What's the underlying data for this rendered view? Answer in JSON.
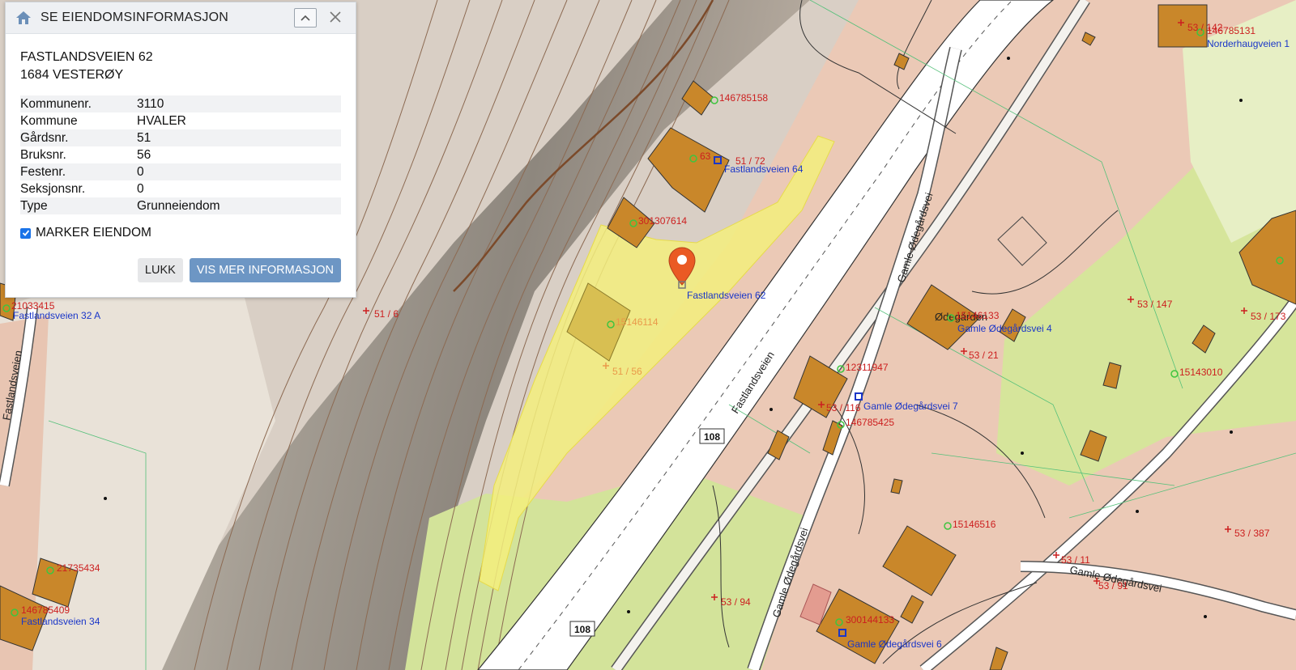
{
  "panel": {
    "title": "SE EIENDOMSINFORMASJON",
    "address_line1": "FASTLANDSVEIEN 62",
    "address_line2": "1684 VESTERØY",
    "properties": [
      {
        "key": "Kommunenr.",
        "value": "3110"
      },
      {
        "key": "Kommune",
        "value": "HVALER"
      },
      {
        "key": "Gårdsnr.",
        "value": "51"
      },
      {
        "key": "Bruksnr.",
        "value": "56"
      },
      {
        "key": "Festenr.",
        "value": "0"
      },
      {
        "key": "Seksjonsnr.",
        "value": "0"
      },
      {
        "key": "Type",
        "value": "Grunneiendom"
      }
    ],
    "mark_property_label": "MARKER EIENDOM",
    "mark_property_checked": true,
    "close_label": "LUKK",
    "more_info_label": "VIS MER INFORMASJON",
    "icons": {
      "home": "home-icon",
      "collapse": "chevron-up-icon",
      "close": "close-icon"
    }
  },
  "map": {
    "road_numbers": [
      "108",
      "108"
    ],
    "road_names": [
      "Fastlandsveien",
      "Gamle Ødegårdsvei",
      "Gamle Ødegårdsvei",
      "Gamle Ødegårdsvei",
      "Fastlandsveien"
    ],
    "place_names": [
      "Ødegården"
    ],
    "addresses": [
      "Fastlandsveien 64",
      "Fastlandsveien 62",
      "Fastlandsveien 32 A",
      "Fastlandsveien 34",
      "Gamle Ødegårdsvei 4",
      "Gamle Ødegårdsvei 7",
      "Gamle Ødegårdsvei 6",
      "Norderhaugveien 1"
    ],
    "building_ids": [
      "146785158",
      "301307614",
      "15146114",
      "12311947",
      "146785425",
      "15146516",
      "15143010",
      "21735434",
      "146785409",
      "300144133",
      "146785131",
      "21033415",
      "63",
      "15146133"
    ],
    "parcel_labels": [
      "51 / 72",
      "51 / 56",
      "51 / 6",
      "53 / 116",
      "53 / 21",
      "53 / 147",
      "53 / 173",
      "53 / 387",
      "53 / 11",
      "53 / 91",
      "53 / 94",
      "53 / 142"
    ],
    "colors": {
      "terrain": "#d8cfc4",
      "slope": "#a59e93",
      "farmland": "#ebc7b2",
      "forest": "#d3e39a",
      "highlight": "#f1eb7a",
      "road": "#ffffff",
      "building": "#c9872a",
      "marker": "#ea5a24",
      "parcel_label": "#cc1f1f",
      "address_label": "#1a36c8",
      "building_id": "#cc1f1f"
    }
  }
}
